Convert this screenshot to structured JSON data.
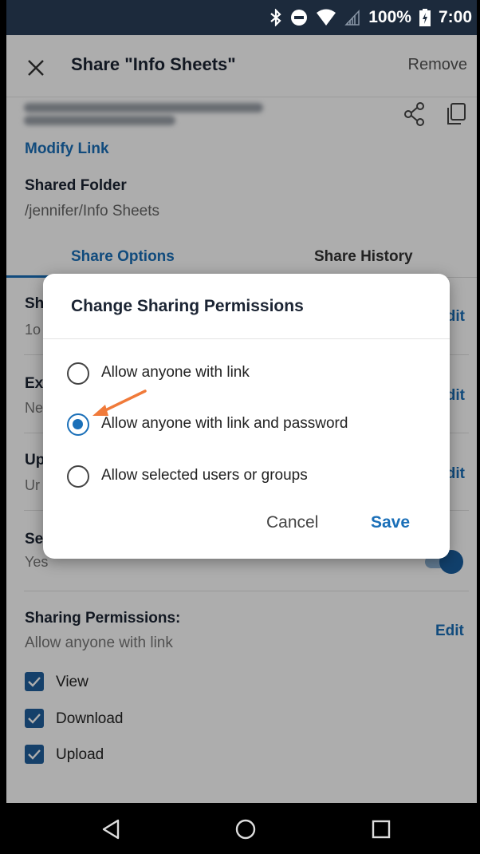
{
  "status_bar": {
    "battery_percent": "100%",
    "time": "7:00",
    "icons": [
      "bluetooth-icon",
      "do-not-disturb-icon",
      "wifi-icon",
      "signal-icon",
      "battery-charging-icon"
    ]
  },
  "app_bar": {
    "title": "Share \"Info Sheets\"",
    "remove_label": "Remove",
    "close_icon": "close-icon"
  },
  "link": {
    "modify_label": "Modify Link",
    "share_icon": "share-icon",
    "copy_icon": "copy-icon"
  },
  "shared_folder": {
    "label": "Shared Folder",
    "path": "/jennifer/Info Sheets"
  },
  "tabs": [
    {
      "label": "Share Options",
      "active": true
    },
    {
      "label": "Share History",
      "active": false
    }
  ],
  "option_rows": [
    {
      "label": "Sh",
      "value": "1o",
      "edit": "dit"
    },
    {
      "label": "Ex",
      "value": "Ne",
      "edit": "dit"
    },
    {
      "label": "Up",
      "value": "Ur",
      "edit": "dit"
    },
    {
      "label": "Se",
      "value": "Yes",
      "toggle_on": true
    }
  ],
  "sharing_permissions": {
    "label": "Sharing Permissions:",
    "value": "Allow anyone with link",
    "edit_label": "Edit",
    "checkboxes": [
      {
        "label": "View",
        "checked": true
      },
      {
        "label": "Download",
        "checked": true
      },
      {
        "label": "Upload",
        "checked": true
      }
    ]
  },
  "dialog": {
    "title": "Change Sharing Permissions",
    "options": [
      {
        "label": "Allow anyone with link",
        "selected": false
      },
      {
        "label": "Allow anyone with link and password",
        "selected": true
      },
      {
        "label": "Allow selected users or groups",
        "selected": false
      }
    ],
    "cancel_label": "Cancel",
    "save_label": "Save",
    "annotation_arrow_color": "#f07a3a"
  },
  "nav_bar": {
    "buttons": [
      "back-icon",
      "home-icon",
      "recents-icon"
    ]
  },
  "colors": {
    "accent": "#1a6fb8",
    "status_bar": "#1c2a3c",
    "checkbox": "#1f5f9c"
  }
}
